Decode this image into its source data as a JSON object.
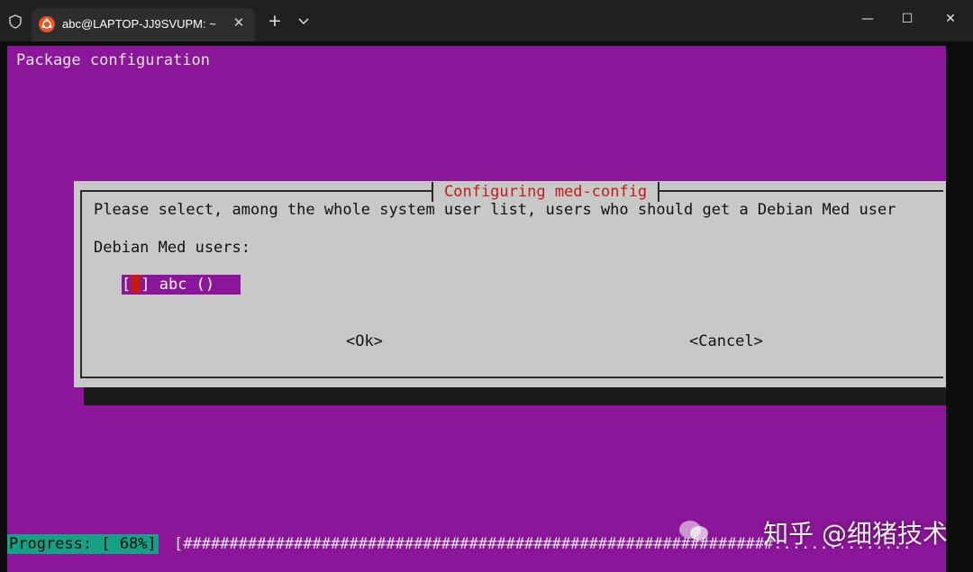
{
  "window": {
    "tab_title": "abc@LAPTOP-JJ9SVUPM: ~",
    "tab_close": "✕",
    "new_tab": "+",
    "minimize": "—",
    "maximize": "☐",
    "close": "✕"
  },
  "terminal": {
    "heading": "Package configuration",
    "dialog": {
      "title": "Configuring med-config",
      "prompt": "Please select, among the whole system user list, users who should get a Debian Med user",
      "users_label": "Debian Med users:",
      "user_items": [
        {
          "open": "[",
          "close": "] abc ()",
          "checked": false
        }
      ],
      "ok_button": "<Ok>",
      "cancel_button": "<Cancel>"
    },
    "progress": {
      "label": "Progress: [ 68%]",
      "percent": 68,
      "bar": "[################################################################..............."
    }
  },
  "watermark": {
    "text": "知乎 @细猪技术"
  },
  "colors": {
    "terminal_bg": "#8c1699",
    "dialog_bg": "#c8c8c8",
    "dialog_title": "#c41a1a",
    "progress_bg": "#16a085",
    "ubuntu_orange": "#e95420"
  },
  "icons": {
    "shield": "shield-icon",
    "ubuntu": "ubuntu-icon",
    "dropdown": "chevron-down-icon"
  }
}
